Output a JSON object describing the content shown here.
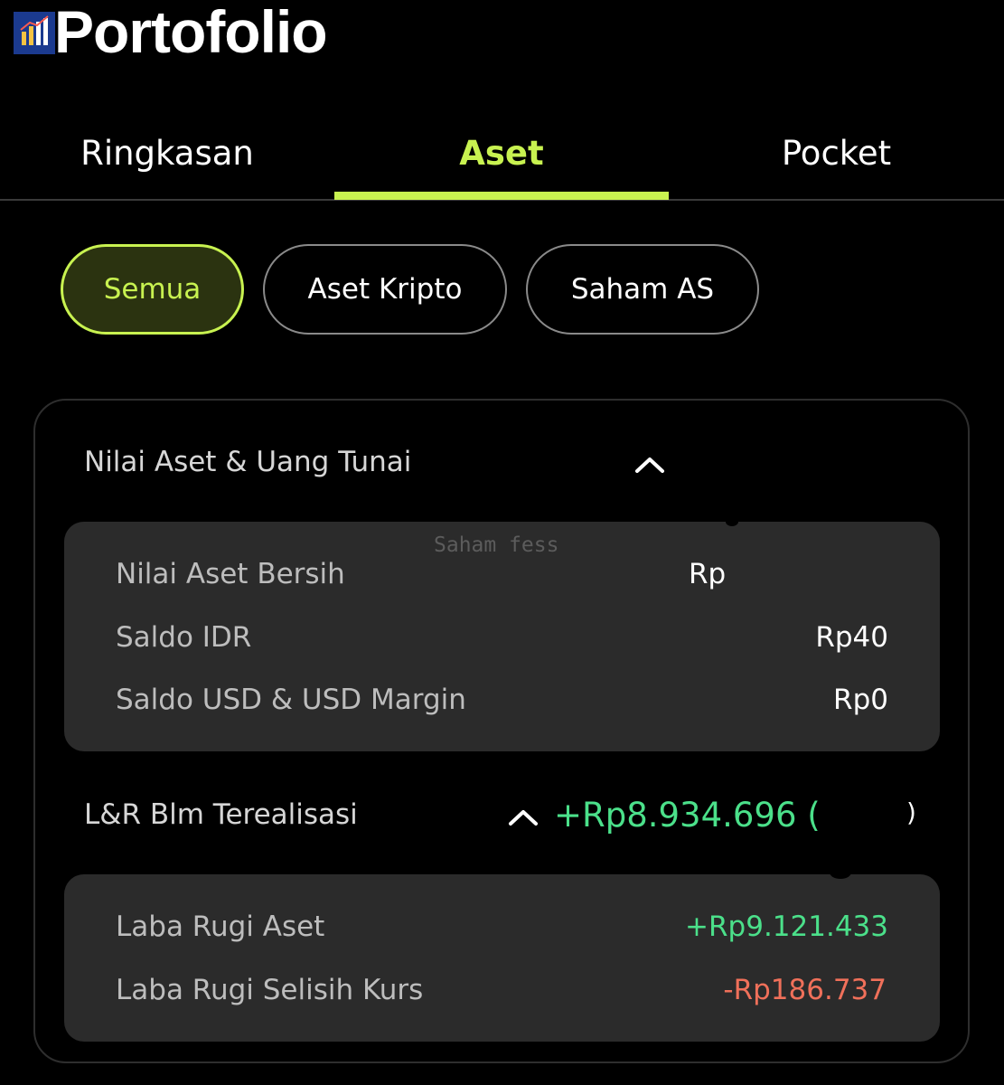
{
  "header": {
    "title": "Portofolio",
    "logo_icon": "bar-chart-icon",
    "logo_caption": "Saham Fess"
  },
  "tabs": [
    {
      "label": "Ringkasan",
      "active": false
    },
    {
      "label": "Aset",
      "active": true
    },
    {
      "label": "Pocket",
      "active": false
    }
  ],
  "filters": [
    {
      "label": "Semua",
      "selected": true
    },
    {
      "label": "Aset Kripto",
      "selected": false
    },
    {
      "label": "Saham AS",
      "selected": false
    }
  ],
  "colors": {
    "accent": "#c8f250",
    "profit": "#4be08a",
    "loss": "#f0705a",
    "panel": "#2b2b2b",
    "background": "#000000"
  },
  "asset_section": {
    "label": "Nilai Aset & Uang Tunai",
    "toggle_icon": "chevron-up-icon",
    "watermark": "Saham fess",
    "rows": [
      {
        "label": "Nilai Aset Bersih",
        "value": "Rp"
      },
      {
        "label": "Saldo IDR",
        "value": "Rp40"
      },
      {
        "label": "Saldo USD & USD Margin",
        "value": "Rp0"
      }
    ]
  },
  "pnl_section": {
    "label": "L&R Blm Terealisasi",
    "toggle_icon": "chevron-up-icon",
    "total": "+Rp8.934.696 (",
    "total_close": ")",
    "rows": [
      {
        "label": "Laba Rugi Aset",
        "value": "+Rp9.121.433"
      },
      {
        "label": "Laba Rugi Selisih Kurs",
        "value": "-Rp186.737"
      }
    ]
  }
}
